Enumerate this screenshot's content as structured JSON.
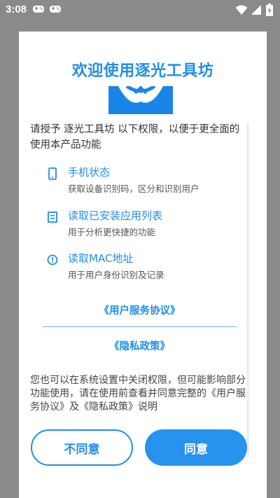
{
  "status_bar": {
    "time": "3:08"
  },
  "dialog": {
    "title": "欢迎使用逐光工具坊",
    "intro": "请授予 逐光工具坊 以下权限，以便于更全面的使用本产品功能",
    "permissions": [
      {
        "title": "手机状态",
        "desc": "获取设备识别码，区分和识别用户",
        "icon": "phone-icon"
      },
      {
        "title": "读取已安装应用列表",
        "desc": "用于分析更快捷的功能",
        "icon": "list-icon"
      },
      {
        "title": "读取MAC地址",
        "desc": "用于用户身份识别及记录",
        "icon": "info-icon"
      }
    ],
    "links": {
      "user_agreement": "《用户服务协议》",
      "privacy_policy": "《隐私政策》"
    },
    "footnote": "您也可以在系统设置中关闭权限，但可能影响部分功能使用，请在使用前查看并同意完整的《用户服务协议》及《隐私政策》说明",
    "buttons": {
      "decline": "不同意",
      "agree": "同意"
    }
  },
  "colors": {
    "accent": "#1f8ee8",
    "overlay": "#8a8a8a"
  }
}
